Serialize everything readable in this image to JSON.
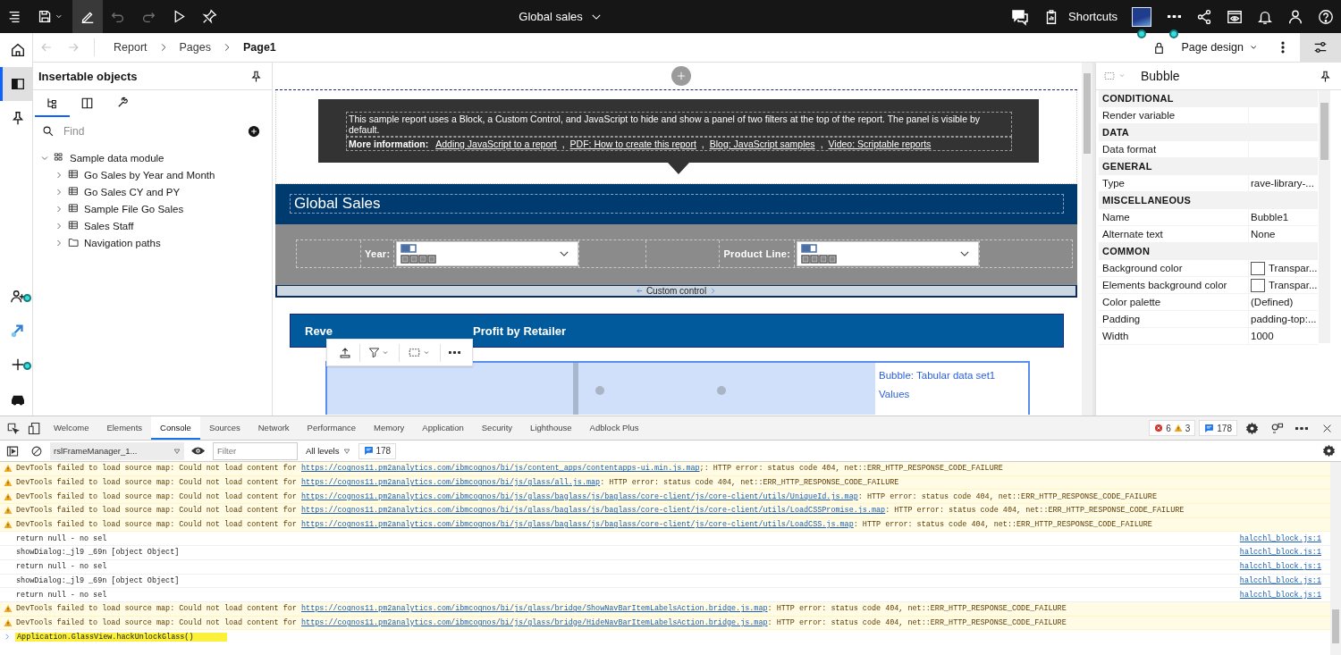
{
  "top_bar": {
    "edit_mode": true,
    "undo_disabled": true,
    "redo_disabled": true,
    "title": "Global sales",
    "shortcuts": "Shortcuts"
  },
  "breadcrumb": [
    {
      "label": "Report",
      "selected": false
    },
    {
      "label": "Pages",
      "selected": false
    },
    {
      "label": "Page1",
      "selected": true
    }
  ],
  "view_menu": "Page design",
  "rail_items": [
    {
      "selected": false,
      "notified": false
    },
    {
      "selected": true,
      "notified": false
    },
    {
      "selected": false,
      "notified": false
    },
    {
      "selected": false,
      "notified": true
    },
    {
      "selected": false,
      "notified": false
    },
    {
      "selected": false,
      "notified": true
    },
    {
      "selected": false,
      "notified": false
    }
  ],
  "insertable": {
    "title": "Insertable objects",
    "tabs": [
      {
        "selected": true
      },
      {
        "selected": false
      },
      {
        "selected": false
      }
    ],
    "search_placeholder": "Find",
    "tree": [
      {
        "label": "Sample data module",
        "kind": "module",
        "expanded": true,
        "children": [
          {
            "label": "Go Sales by Year and Month",
            "kind": "table",
            "expanded": false
          },
          {
            "label": "Go Sales CY and PY",
            "kind": "table",
            "expanded": false
          },
          {
            "label": "Sample File Go Sales",
            "kind": "table",
            "expanded": false
          },
          {
            "label": "Sales Staff",
            "kind": "table",
            "expanded": false
          },
          {
            "label": "Navigation paths",
            "kind": "folder",
            "expanded": false
          }
        ]
      }
    ]
  },
  "report": {
    "intro": "This sample report uses a Block, a Custom Control, and JavaScript to hide and show a panel of two filters at the top of the report. The panel is visible by default.",
    "more_label": "More information:",
    "separator": ",",
    "links": [
      "Adding JavaScript to a report",
      "PDF: How to create this report",
      "Blog: JavaScript samples",
      "Video: Scriptable reports"
    ],
    "title": "Global Sales",
    "filters": [
      {
        "label": "Year:"
      },
      {
        "label": "Product Line:"
      }
    ],
    "custom_control": "Custom control",
    "chart_title_parts": [
      "Reve",
      "Profit by Retailer"
    ],
    "legend": [
      "Bubble: Tabular data set1",
      "Values"
    ]
  },
  "properties": {
    "title": "Bubble",
    "sections": [
      {
        "title": "CONDITIONAL",
        "rows": [
          {
            "label": "Render variable",
            "kind": "text"
          }
        ]
      },
      {
        "title": "DATA",
        "rows": [
          {
            "label": "Data format",
            "kind": "text"
          }
        ]
      },
      {
        "title": "GENERAL",
        "rows": [
          {
            "label": "Type",
            "value": "rave-library-...",
            "kind": "text"
          }
        ]
      },
      {
        "title": "MISCELLANEOUS",
        "rows": [
          {
            "label": "Name",
            "value": "Bubble1",
            "kind": "text"
          },
          {
            "label": "Alternate text",
            "value": "None",
            "kind": "text"
          }
        ]
      },
      {
        "title": "COMMON",
        "rows": [
          {
            "label": "Background color",
            "value": "Transpar...",
            "kind": "color"
          },
          {
            "label": "Elements background color",
            "value": "Transpar...",
            "kind": "color"
          },
          {
            "label": "Color palette",
            "value": "(Defined)",
            "kind": "text"
          },
          {
            "label": "Padding",
            "value": "padding-top:...",
            "kind": "text"
          },
          {
            "label": "Width",
            "value": "1000",
            "kind": "text"
          }
        ]
      }
    ]
  },
  "devtools": {
    "tabs": [
      {
        "label": "Welcome",
        "selected": false
      },
      {
        "label": "Elements",
        "selected": false
      },
      {
        "label": "Console",
        "selected": true
      },
      {
        "label": "Sources",
        "selected": false
      },
      {
        "label": "Network",
        "selected": false
      },
      {
        "label": "Performance",
        "selected": false
      },
      {
        "label": "Memory",
        "selected": false
      },
      {
        "label": "Application",
        "selected": false
      },
      {
        "label": "Security",
        "selected": false
      },
      {
        "label": "Lighthouse",
        "selected": false
      },
      {
        "label": "Adblock Plus",
        "selected": false
      }
    ],
    "errors": "6",
    "warnings": "3",
    "messages_count": "178",
    "toolbar_messages_count": "178",
    "context": "rslFrameManager_1...",
    "filter_placeholder": "Filter",
    "levels": "All levels",
    "messages": [
      {
        "kind": "warning",
        "text": "DevTools failed to load source map: Could not load content for",
        "url": "https://cognos11.pm2analytics.com/ibmcognos/bi/js/content_apps/contentapps-ui.min.js.map",
        "after": ";: HTTP error: status code 404, net::ERR_HTTP_RESPONSE_CODE_FAILURE"
      },
      {
        "kind": "warning",
        "text": "DevTools failed to load source map: Could not load content for",
        "url": "https://cognos11.pm2analytics.com/ibmcognos/bi/js/glass/all.js.map",
        "after": ": HTTP error: status code 404, net::ERR_HTTP_RESPONSE_CODE_FAILURE"
      },
      {
        "kind": "warning",
        "text": "DevTools failed to load source map: Could not load content for",
        "url": "https://cognos11.pm2analytics.com/ibmcognos/bi/js/glass/baglass/js/baglass/core-client/js/core-client/utils/UniqueId.js.map",
        "after": ": HTTP error: status code 404, net::ERR_HTTP_RESPONSE_CODE_FAILURE"
      },
      {
        "kind": "warning",
        "text": "DevTools failed to load source map: Could not load content for",
        "url": "https://cognos11.pm2analytics.com/ibmcognos/bi/js/glass/baglass/js/baglass/core-client/js/core-client/utils/LoadCSSPromise.js.map",
        "after": ": HTTP error: status code 404, net::ERR_HTTP_RESPONSE_CODE_FAILURE"
      },
      {
        "kind": "warning",
        "text": "DevTools failed to load source map: Could not load content for",
        "url": "https://cognos11.pm2analytics.com/ibmcognos/bi/js/glass/baglass/js/baglass/core-client/js/core-client/utils/LoadCSS.js.map",
        "after": ": HTTP error: status code 404, net::ERR_HTTP_RESPONSE_CODE_FAILURE"
      },
      {
        "kind": "log",
        "text": "return null - no sel",
        "source": "halcchl_block.js:1"
      },
      {
        "kind": "log",
        "text": "showDialog:_jl9 _69n [object Object]",
        "source": "halcchl_block.js:1"
      },
      {
        "kind": "log",
        "text": "return null - no sel",
        "source": "halcchl_block.js:1"
      },
      {
        "kind": "log",
        "text": "showDialog:_jl9 _69n [object Object]",
        "source": "halcchl_block.js:1"
      },
      {
        "kind": "log",
        "text": "return null - no sel",
        "source": "halcchl_block.js:1"
      },
      {
        "kind": "warning",
        "text": "DevTools failed to load source map: Could not load content for",
        "url": "https://cognos11.pm2analytics.com/ibmcognos/bi/js/glass/bridge/ShowNavBarItemLabelsAction.bridge.js.map",
        "after": ": HTTP error: status code 404, net::ERR_HTTP_RESPONSE_CODE_FAILURE"
      },
      {
        "kind": "warning",
        "text": "DevTools failed to load source map: Could not load content for",
        "url": "https://cognos11.pm2analytics.com/ibmcognos/bi/js/glass/bridge/HideNavBarItemLabelsAction.bridge.js.map",
        "after": ": HTTP error: status code 404, net::ERR_HTTP_RESPONSE_CODE_FAILURE"
      }
    ],
    "input": "Application.GlassView.hackUnlockGlass()"
  }
}
